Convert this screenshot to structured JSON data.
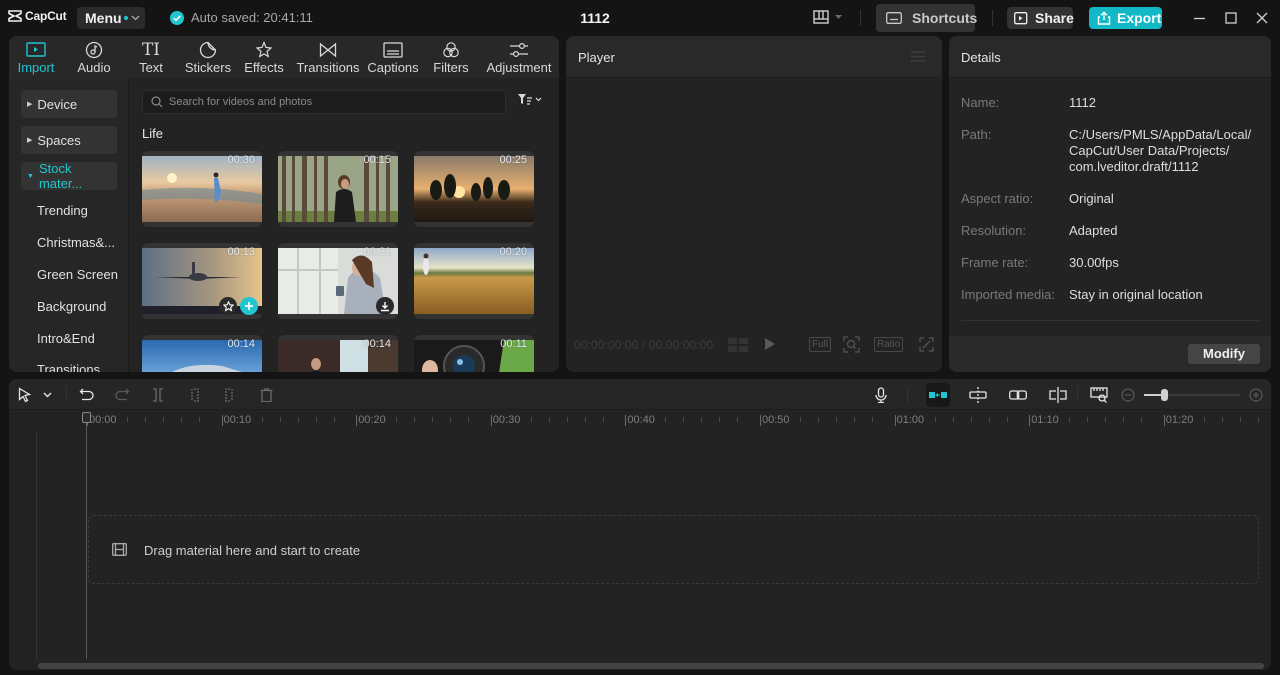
{
  "app": {
    "logo_text": "CapCut",
    "menu_label": "Menu",
    "autosave_text": "Auto saved: 20:41:11",
    "project_title": "1112",
    "shortcuts_label": "Shortcuts",
    "share_label": "Share",
    "export_label": "Export",
    "accent_color": "#20c5cf"
  },
  "media": {
    "tabs": [
      {
        "label": "Import",
        "icon": "import-icon",
        "active": true
      },
      {
        "label": "Audio",
        "icon": "audio-icon"
      },
      {
        "label": "Text",
        "icon": "text-icon"
      },
      {
        "label": "Stickers",
        "icon": "stickers-icon"
      },
      {
        "label": "Effects",
        "icon": "effects-icon"
      },
      {
        "label": "Transitions",
        "icon": "transitions-icon"
      },
      {
        "label": "Captions",
        "icon": "captions-icon"
      },
      {
        "label": "Filters",
        "icon": "filters-icon"
      },
      {
        "label": "Adjustment",
        "icon": "adjustment-icon"
      }
    ],
    "sidebar": {
      "groups": [
        {
          "label": "Device",
          "expanded": false
        },
        {
          "label": "Spaces",
          "expanded": false
        },
        {
          "label": "Stock mater...",
          "expanded": true
        }
      ],
      "items": [
        "Trending",
        "Christmas&...",
        "Green Screen",
        "Background",
        "Intro&End",
        "Transitions"
      ]
    },
    "search_placeholder": "Search for videos and photos",
    "section_title": "Life",
    "cards": [
      {
        "duration": "00:30",
        "scene": "beach"
      },
      {
        "duration": "00:15",
        "scene": "forest"
      },
      {
        "duration": "00:25",
        "scene": "sunset-kids"
      },
      {
        "duration": "00:13",
        "scene": "airplane",
        "badges": [
          "favorite",
          "add"
        ]
      },
      {
        "duration": "00:21",
        "scene": "woman-phone",
        "badges": [
          "download"
        ]
      },
      {
        "duration": "00:20",
        "scene": "wheat-field"
      },
      {
        "duration": "00:14",
        "scene": "car"
      },
      {
        "duration": "00:14",
        "scene": "presenter"
      },
      {
        "duration": "00:11",
        "scene": "camera"
      }
    ]
  },
  "player": {
    "title": "Player",
    "current_time": "00:00:00:00",
    "total_time": "00:00:00:00",
    "full_label": "Full",
    "ratio_label": "Ratio"
  },
  "details": {
    "title": "Details",
    "rows": [
      {
        "key": "Name:",
        "value": "1112"
      },
      {
        "key": "Path:",
        "value": "C:/Users/PMLS/AppData/Local/ CapCut/User Data/Projects/ com.lveditor.draft/1112"
      },
      {
        "key": "Aspect ratio:",
        "value": "Original"
      },
      {
        "key": "Resolution:",
        "value": "Adapted"
      },
      {
        "key": "Frame rate:",
        "value": "30.00fps"
      },
      {
        "key": "Imported media:",
        "value": "Stay in original location"
      }
    ],
    "modify_label": "Modify"
  },
  "timeline": {
    "ruler_labels": [
      "00:00",
      "00:10",
      "00:20",
      "00:30",
      "00:40",
      "00:50",
      "01:00",
      "01:10",
      "01:20"
    ],
    "drop_text": "Drag material here and start to create",
    "zoom_level": 0.05
  }
}
